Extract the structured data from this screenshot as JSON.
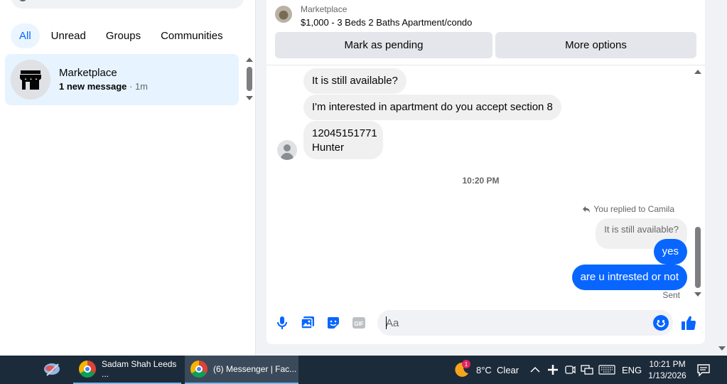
{
  "sidebar": {
    "filters": [
      "All",
      "Unread",
      "Groups",
      "Communities"
    ],
    "conversation": {
      "title": "Marketplace",
      "unread": "1 new message",
      "time": " · 1m"
    }
  },
  "listing": {
    "label": "Marketplace",
    "title": "$1,000 - 3 Beds 2 Baths Apartment/condo",
    "mark_pending": "Mark as pending",
    "more_options": "More options"
  },
  "messages": {
    "incoming": [
      "It is still available?",
      "I'm interested in apartment do you accept section 8",
      "12045151771",
      "Hunter"
    ],
    "timestamp": "10:20 PM",
    "replied_to": "You replied to Camila",
    "reply_quote": "It is still available?",
    "outgoing": [
      "yes",
      "are u intrested or not"
    ],
    "status": "Sent"
  },
  "composer": {
    "placeholder": "Aa"
  },
  "taskbar": {
    "apps": [
      "Sadam Shah Leeds ...",
      "(6) Messenger | Fac..."
    ],
    "weather": "8°C  Clear",
    "weather_badge": "1",
    "language": "ENG",
    "time": "10:21 PM",
    "date": "1/13/2026"
  },
  "colors": {
    "accent": "#0866ff",
    "selected_bg": "#e7f3ff",
    "taskbar": "#1c2b3a"
  }
}
